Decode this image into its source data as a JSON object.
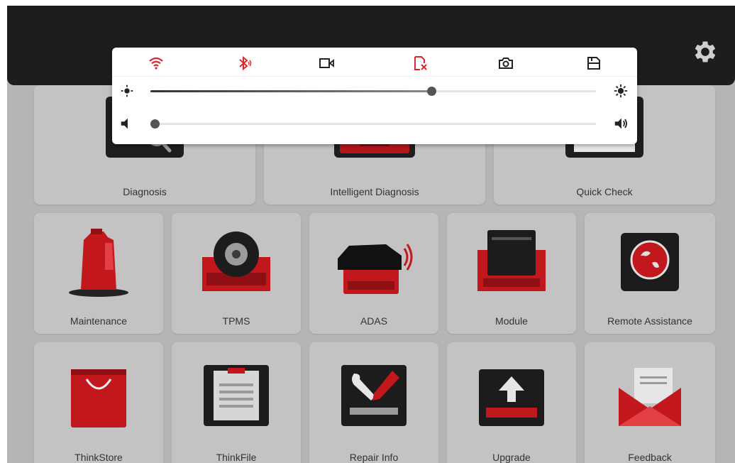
{
  "colors": {
    "accent": "#d9272e",
    "dark": "#1d1d1d",
    "tile": "#c3c3c3",
    "background": "#b5b5b5"
  },
  "header": {
    "settings_icon": "gear-icon"
  },
  "quick_panel": {
    "toggles": [
      {
        "name": "wifi",
        "icon": "wifi-icon",
        "active": true
      },
      {
        "name": "bluetooth",
        "icon": "bluetooth-icon",
        "active": true
      },
      {
        "name": "screen-record",
        "icon": "video-record-icon",
        "active": false
      },
      {
        "name": "no-sim",
        "icon": "sim-off-icon",
        "active": true
      },
      {
        "name": "screenshot",
        "icon": "camera-icon",
        "active": false
      },
      {
        "name": "screen-capture",
        "icon": "screen-capture-icon",
        "active": false
      }
    ],
    "brightness": {
      "icon": "brightness-low-icon",
      "icon_end": "brightness-high-icon",
      "level": 0.63
    },
    "volume": {
      "icon": "volume-low-icon",
      "icon_end": "volume-high-icon",
      "level": 0.01
    }
  },
  "apps": {
    "row1": [
      {
        "label": "Diagnosis",
        "icon": "diagnosis-search-icon"
      },
      {
        "label": "Intelligent Diagnosis",
        "icon": "intelligent-diagnosis-icon"
      },
      {
        "label": "Quick Check",
        "icon": "quick-check-icon"
      }
    ],
    "row2": [
      {
        "label": "Maintenance",
        "icon": "oil-can-icon"
      },
      {
        "label": "TPMS",
        "icon": "tire-icon"
      },
      {
        "label": "ADAS",
        "icon": "car-sensor-icon"
      },
      {
        "label": "Module",
        "icon": "module-icon"
      },
      {
        "label": "Remote Assistance",
        "icon": "remote-assistance-icon"
      }
    ],
    "row3": [
      {
        "label": "ThinkStore",
        "icon": "shopping-bag-icon"
      },
      {
        "label": "ThinkFile",
        "icon": "clipboard-icon"
      },
      {
        "label": "Repair Info",
        "icon": "wrench-icon"
      },
      {
        "label": "Upgrade",
        "icon": "upload-icon"
      },
      {
        "label": "Feedback",
        "icon": "envelope-icon"
      }
    ]
  }
}
